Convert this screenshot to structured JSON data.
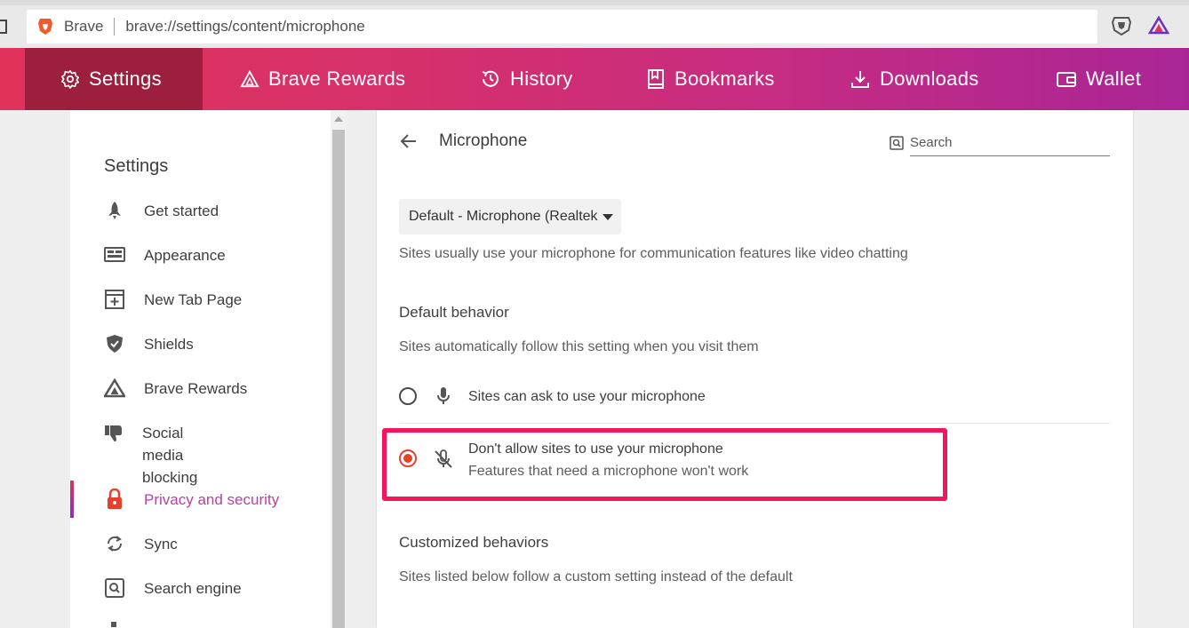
{
  "browser": {
    "site_name": "Brave",
    "url": "brave://settings/content/microphone"
  },
  "topnav": {
    "items": [
      {
        "label": "Settings",
        "icon": "gear-icon"
      },
      {
        "label": "Brave Rewards",
        "icon": "brave-rewards-icon"
      },
      {
        "label": "History",
        "icon": "history-icon"
      },
      {
        "label": "Bookmarks",
        "icon": "bookmarks-icon"
      },
      {
        "label": "Downloads",
        "icon": "download-icon"
      },
      {
        "label": "Wallet",
        "icon": "wallet-icon"
      }
    ]
  },
  "sidebar": {
    "title": "Settings",
    "items": [
      {
        "label": "Get started",
        "icon": "rocket-icon"
      },
      {
        "label": "Appearance",
        "icon": "appearance-icon"
      },
      {
        "label": "New Tab Page",
        "icon": "new-tab-icon"
      },
      {
        "label": "Shields",
        "icon": "shield-icon"
      },
      {
        "label": "Brave Rewards",
        "icon": "brave-rewards-icon"
      },
      {
        "label": "Social media blocking",
        "icon": "thumbs-down-icon"
      },
      {
        "label": "Privacy and security",
        "icon": "lock-icon"
      },
      {
        "label": "Sync",
        "icon": "sync-icon"
      },
      {
        "label": "Search engine",
        "icon": "search-engine-icon"
      }
    ]
  },
  "main": {
    "title": "Microphone",
    "search_placeholder": "Search",
    "device_select": "Default - Microphone (Realtek High Definition Audio)",
    "device_description": "Sites usually use your microphone for communication features like video chatting",
    "default_behavior": {
      "heading": "Default behavior",
      "description": "Sites automatically follow this setting when you visit them",
      "options": [
        {
          "label": "Sites can ask to use your microphone",
          "checked": false
        },
        {
          "label": "Don't allow sites to use your microphone",
          "sub": "Features that need a microphone won't work",
          "checked": true
        }
      ]
    },
    "customized": {
      "heading": "Customized behaviors",
      "description": "Sites listed below follow a custom setting instead of the default"
    }
  },
  "colors": {
    "accent": "#e5412c",
    "highlight": "#f4155b",
    "active_nav": "#9c1f3e",
    "active_sidebar": "#b93fa5"
  }
}
